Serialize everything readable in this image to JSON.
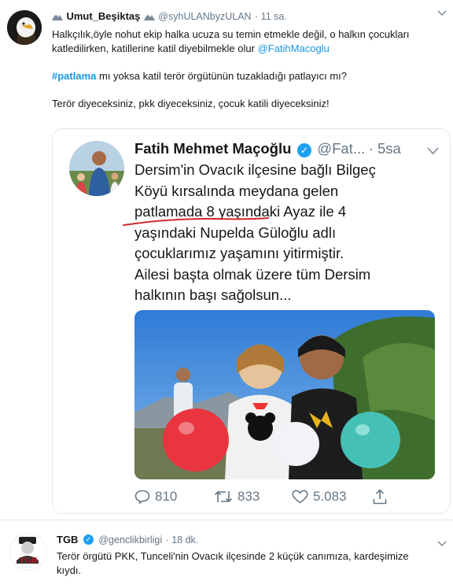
{
  "tweet1": {
    "display_name": "Umut_Beşiktaş",
    "handle": "@syhULANbyzULAN",
    "time": "· 11 sa.",
    "text_line1": "Halkçılık,öyle nohut ekip halka ucuza su temin etmekle değil, o halkın çocukları",
    "text_line2_prefix": "katledilirken, katillerine katil diyebilmekle olur ",
    "mention": "@FatihMacoglu",
    "hashtag": "#patlama",
    "hashtag_suffix": " mı yoksa katil terör örgütünün tuzakladığı patlayıcı mı?",
    "text_line4": "Terör diyeceksiniz, pkk diyeceksiniz, çocuk katili diyeceksiniz!"
  },
  "quoted": {
    "display_name": "Fatih Mehmet Maçoğlu",
    "handle": "@Fat...",
    "time": "· 5sa",
    "lines": [
      "Dersim'in Ovacık ilçesine bağlı Bilgeç",
      "Köyü kırsalında meydana gelen",
      "patlamada 8 yaşındaki Ayaz ile 4",
      "yaşındaki Nupelda Güloğlu adlı",
      "çocuklarımız yaşamını yitirmiştir.",
      " Ailesi başta olmak üzere tüm Dersim",
      "halkının başı sağolsun..."
    ]
  },
  "actions": {
    "replies": "810",
    "retweets": "833",
    "likes": "5.083"
  },
  "tweet2": {
    "display_name": "TGB",
    "handle": "@genclikbirligi",
    "time": "· 18 dk.",
    "text_line1": "Terör örgütü PKK, Tunceli'nin Ovacık ilçesinde 2 küçük canımıza, kardeşimize",
    "text_line2": "kıydı.",
    "avatar_text": "TGB"
  },
  "colors": {
    "link": "#1b95e0",
    "verified": "#1da1f2",
    "underline": "#d12a2a"
  },
  "icons": [
    "eagle-avatar-icon",
    "mountain-emoji-icon",
    "verified-badge-icon",
    "chevron-down-icon",
    "reply-icon",
    "retweet-icon",
    "like-icon",
    "share-icon"
  ]
}
